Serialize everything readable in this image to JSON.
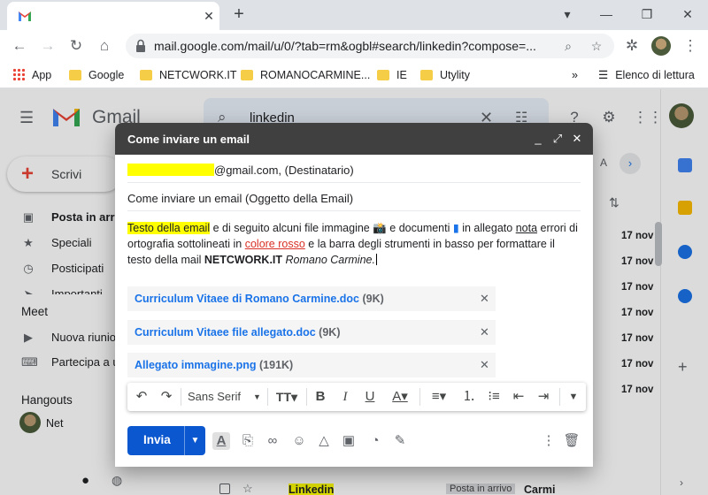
{
  "browser": {
    "tab_close": "✕",
    "new_tab": "+",
    "url": "mail.google.com/mail/u/0/?tab=rm&ogbl#search/linkedin?compose=...",
    "window_buttons": [
      "minimize",
      "maximize",
      "close"
    ],
    "bookmarks": [
      "App",
      "Google",
      "NETCWORK.IT",
      "ROMANOCARMINE...",
      "IE",
      "Utylity"
    ],
    "bookmarks_more": "»",
    "reading_list": "Elenco di lettura"
  },
  "gmail": {
    "logo_text": "Gmail",
    "search_query": "linkedin",
    "compose_label": "Scrivi",
    "nav": [
      {
        "label": "Posta in arrivo",
        "icon": "inbox-icon"
      },
      {
        "label": "Speciali",
        "icon": "star-icon"
      },
      {
        "label": "Posticipati",
        "icon": "clock-icon"
      },
      {
        "label": "Importanti",
        "icon": "label-important-icon"
      }
    ],
    "meet_title": "Meet",
    "meet_items": [
      "Nuova riunione",
      "Partecipa a una riunione"
    ],
    "hangouts_title": "Hangouts",
    "hangouts_user": "Net",
    "dates": [
      "17 nov",
      "17 nov",
      "17 nov",
      "17 nov",
      "17 nov",
      "17 nov",
      "17 nov"
    ],
    "bottom_row": {
      "sender": "Linkedin",
      "label": "Posta in arrivo",
      "subject": "Carmi"
    }
  },
  "compose": {
    "title": "Come inviare un email",
    "to_suffix": "@gmail.com, (Destinatario)",
    "subject": "Come inviare un email (Oggetto della Email)",
    "body": {
      "p1": "Testo della email",
      "p2": " e di seguito alcuni file immagine ",
      "p3": " e documenti ",
      "p4": " in allegato ",
      "p5": "nota",
      "p6": " errori di ortografia sottolineati in ",
      "p7": "colore rosso",
      "p8": " e la barra degli strumenti in basso per formattare il testo della mail ",
      "p9": "NETCWORK.IT",
      "p10": "Romano Carmine."
    },
    "attachments": [
      {
        "name": "Curriculum Vitaee di Romano Carmine.doc",
        "size": "(9K)"
      },
      {
        "name": "Curriculum Vitaee file allegato.doc",
        "size": "(9K)"
      },
      {
        "name": "Allegato immagine.png",
        "size": "(191K)"
      }
    ],
    "font_name": "Sans Serif",
    "send_label": "Invia"
  },
  "colors": {
    "accent": "#0b57d0",
    "highlight": "#ffff00",
    "header": "#404040",
    "spell_error": "#d93025"
  }
}
